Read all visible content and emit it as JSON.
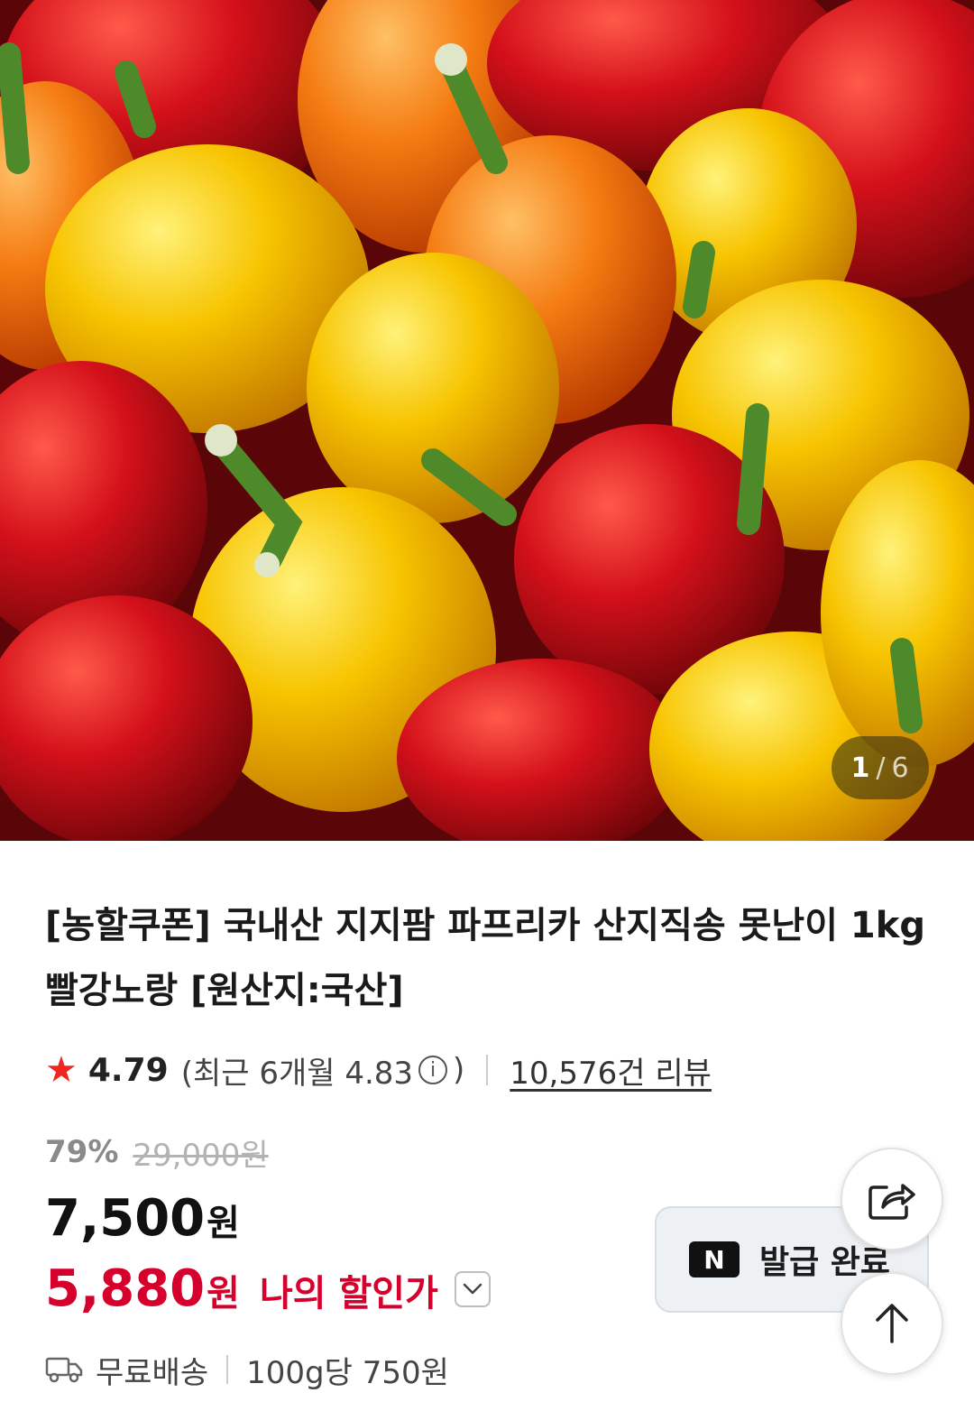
{
  "gallery": {
    "current": "1",
    "separator": "/",
    "total": "6"
  },
  "product": {
    "title": "[농할쿠폰] 국내산 지지팜 파프리카 산지직송 못난이 1kg 빨강노랑 [원산지:국산]"
  },
  "rating": {
    "star": "★",
    "score": "4.79",
    "recent_open": "(최근 6개월 4.83",
    "info_icon": "ⓘ",
    "recent_close": ")",
    "reviews": "10,576건 리뷰"
  },
  "price": {
    "discount_percent": "79%",
    "original_price": "29,000원",
    "sale_price": "7,500",
    "sale_unit": "원",
    "my_price": "5,880",
    "my_unit": "원",
    "my_label": "나의 할인가"
  },
  "shipping": {
    "label": "무료배송",
    "unit_price": "100g당 750원"
  },
  "coupon": {
    "logo": "N",
    "label": "발급 완료"
  },
  "icons": {
    "share": "share-icon",
    "scroll_top": "arrow-up-icon",
    "truck": "truck-icon",
    "chevron": "chevron-down-icon"
  },
  "colors": {
    "accent_red": "#d6002c",
    "star": "#f0271f",
    "muted": "#8a8a8a"
  }
}
